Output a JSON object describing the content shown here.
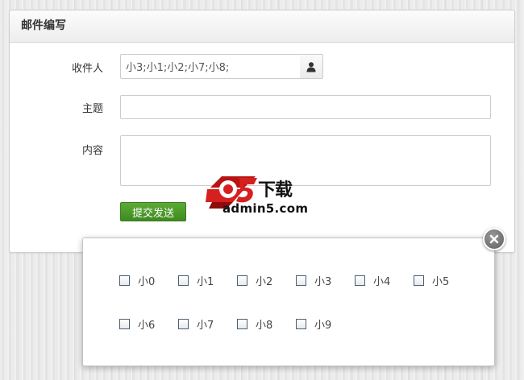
{
  "panel": {
    "title": "邮件编写"
  },
  "form": {
    "recipient_label": "收件人",
    "recipient_value": "小3;小1;小2;小7;小8;",
    "subject_label": "主题",
    "subject_value": "",
    "content_label": "内容",
    "content_value": "",
    "submit_label": "提交发送"
  },
  "popup": {
    "options": [
      {
        "label": "小0",
        "checked": false
      },
      {
        "label": "小1",
        "checked": false
      },
      {
        "label": "小2",
        "checked": false
      },
      {
        "label": "小3",
        "checked": false
      },
      {
        "label": "小4",
        "checked": false
      },
      {
        "label": "小5",
        "checked": false
      },
      {
        "label": "小6",
        "checked": false
      },
      {
        "label": "小7",
        "checked": false
      },
      {
        "label": "小8",
        "checked": false
      },
      {
        "label": "小9",
        "checked": false
      }
    ]
  },
  "watermark": {
    "brand": "admin5.com",
    "title": "下载",
    "logo_text": "a5"
  },
  "icons": {
    "recipient_addon": "user-icon",
    "popup_close": "close-icon"
  },
  "colors": {
    "submit_bg": "#4a9a2a",
    "close_bg": "#6e6e6e",
    "watermark_red": "#d61f1f"
  }
}
